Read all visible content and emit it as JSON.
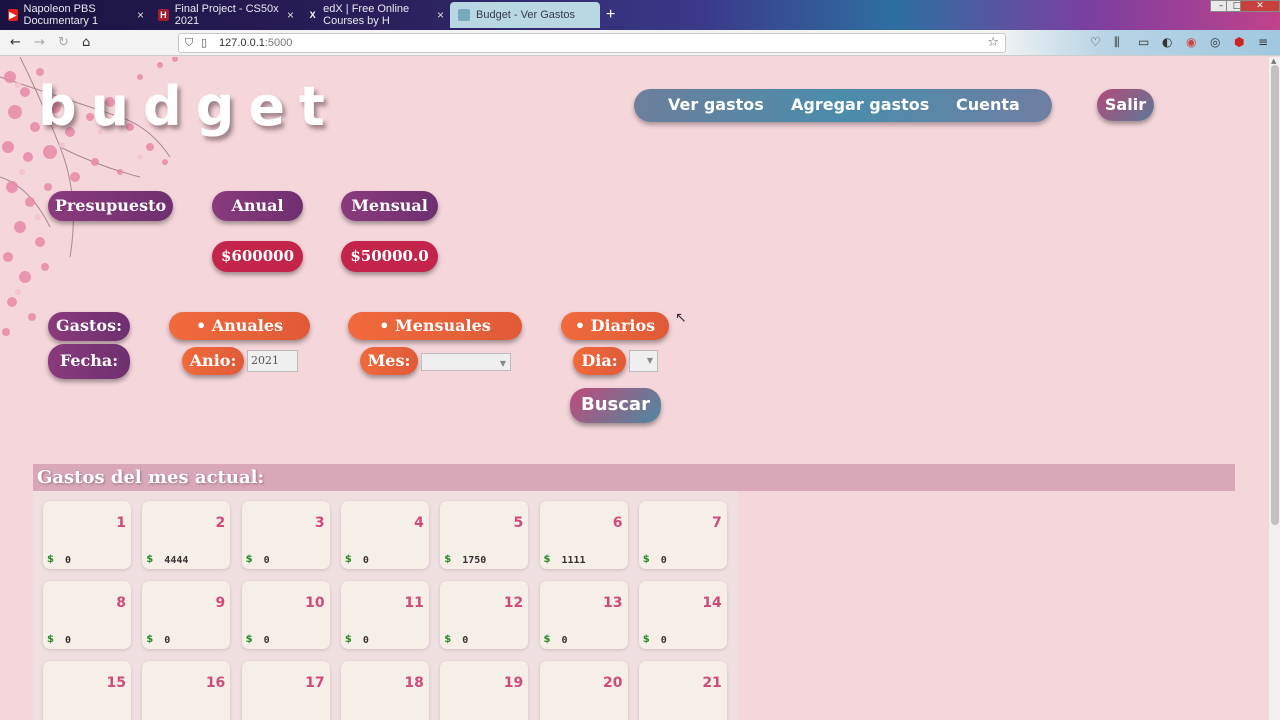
{
  "browser": {
    "tabs": [
      {
        "label": "Napoleon PBS Documentary 1",
        "icon": "youtube-icon"
      },
      {
        "label": "Final Project - CS50x 2021",
        "icon": "harvard-icon"
      },
      {
        "label": "edX | Free Online Courses by H",
        "icon": "edx-icon"
      },
      {
        "label": "Budget - Ver Gastos",
        "icon": "page-icon"
      }
    ],
    "new_tab": "+",
    "url_host": "127.0.0.1",
    "url_port": ":5000"
  },
  "app": {
    "logo": "budget",
    "nav": {
      "ver_gastos": "Ver gastos",
      "agregar_gastos": "Agregar gastos",
      "cuenta": "Cuenta"
    },
    "logout": "Salir"
  },
  "budget": {
    "label": "Presupuesto",
    "anual_label": "Anual",
    "mensual_label": "Mensual",
    "anual_value": "$600000",
    "mensual_value": "$50000.0"
  },
  "filters": {
    "gastos_label": "Gastos:",
    "fecha_label": "Fecha:",
    "anuales": "• Anuales",
    "mensuales": "• Mensuales",
    "diarios": "• Diarios",
    "anio_label": "Anio:",
    "anio_value": "2021",
    "mes_label": "Mes:",
    "mes_value": "",
    "dia_label": "Dia:",
    "dia_value": "",
    "search_button": "Buscar"
  },
  "calendar": {
    "title": "Gastos del mes actual:",
    "currency": "$",
    "days": [
      {
        "day": "1",
        "amount": "0"
      },
      {
        "day": "2",
        "amount": "4444"
      },
      {
        "day": "3",
        "amount": "0"
      },
      {
        "day": "4",
        "amount": "0"
      },
      {
        "day": "5",
        "amount": "1750"
      },
      {
        "day": "6",
        "amount": "1111"
      },
      {
        "day": "7",
        "amount": "0"
      },
      {
        "day": "8",
        "amount": "0"
      },
      {
        "day": "9",
        "amount": "0"
      },
      {
        "day": "10",
        "amount": "0"
      },
      {
        "day": "11",
        "amount": "0"
      },
      {
        "day": "12",
        "amount": "0"
      },
      {
        "day": "13",
        "amount": "0"
      },
      {
        "day": "14",
        "amount": "0"
      },
      {
        "day": "15",
        "amount": ""
      },
      {
        "day": "16",
        "amount": ""
      },
      {
        "day": "17",
        "amount": ""
      },
      {
        "day": "18",
        "amount": ""
      },
      {
        "day": "19",
        "amount": ""
      },
      {
        "day": "20",
        "amount": ""
      },
      {
        "day": "21",
        "amount": ""
      }
    ]
  }
}
